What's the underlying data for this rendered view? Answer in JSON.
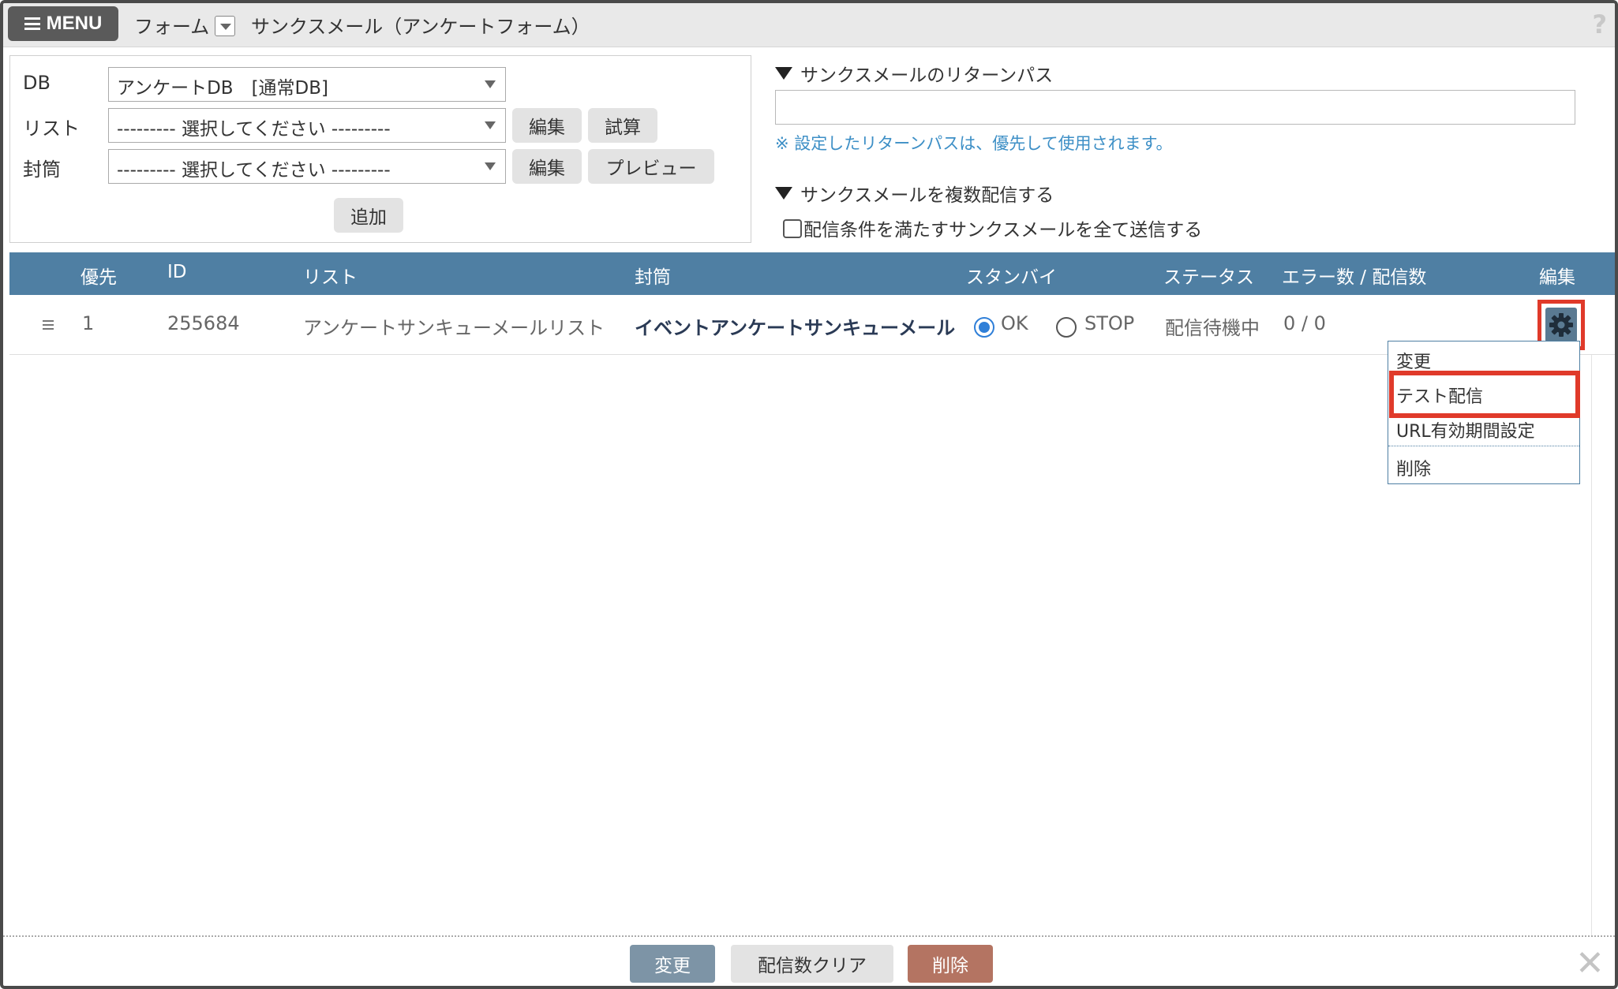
{
  "header": {
    "menu_label": "MENU",
    "breadcrumb": "フォーム",
    "title": "サンクスメール（アンケートフォーム）",
    "help": "?"
  },
  "left_panel": {
    "db_label": "DB",
    "db_value": "アンケートDB　[通常DB]",
    "list_label": "リスト",
    "list_value": "--------- 選択してください ---------",
    "list_edit": "編集",
    "list_calc": "試算",
    "envelope_label": "封筒",
    "envelope_value": "--------- 選択してください ---------",
    "envelope_edit": "編集",
    "envelope_preview": "プレビュー",
    "add": "追加"
  },
  "return_path": {
    "title": "サンクスメールのリターンパス",
    "value": "",
    "note": "※ 設定したリターンパスは、優先して使用されます。"
  },
  "multi": {
    "title": "サンクスメールを複数配信する",
    "checkbox_label": "配信条件を満たすサンクスメールを全て送信する",
    "checked": false
  },
  "table": {
    "headers": {
      "priority": "優先",
      "id": "ID",
      "list": "リスト",
      "envelope": "封筒",
      "standby": "スタンバイ",
      "status": "ステータス",
      "errors": "エラー数 / 配信数",
      "edit": "編集"
    },
    "rows": [
      {
        "priority": "1",
        "id": "255684",
        "list": "アンケートサンキューメールリスト",
        "envelope": "イベントアンケートサンキューメール",
        "ok": "OK",
        "stop": "STOP",
        "selected": "OK",
        "status": "配信待機中",
        "counts": "0 / 0"
      }
    ]
  },
  "dropdown": {
    "items": [
      "変更",
      "テスト配信",
      "URL有効期間設定",
      "削除"
    ]
  },
  "footer": {
    "change": "変更",
    "clear": "配信数クリア",
    "delete": "削除"
  },
  "colors": {
    "table_header": "#4f7fa3",
    "highlight": "#e03a2a",
    "delete_button": "#b47462",
    "change_button": "#7d94a6",
    "note_text": "#3d8fc6"
  }
}
